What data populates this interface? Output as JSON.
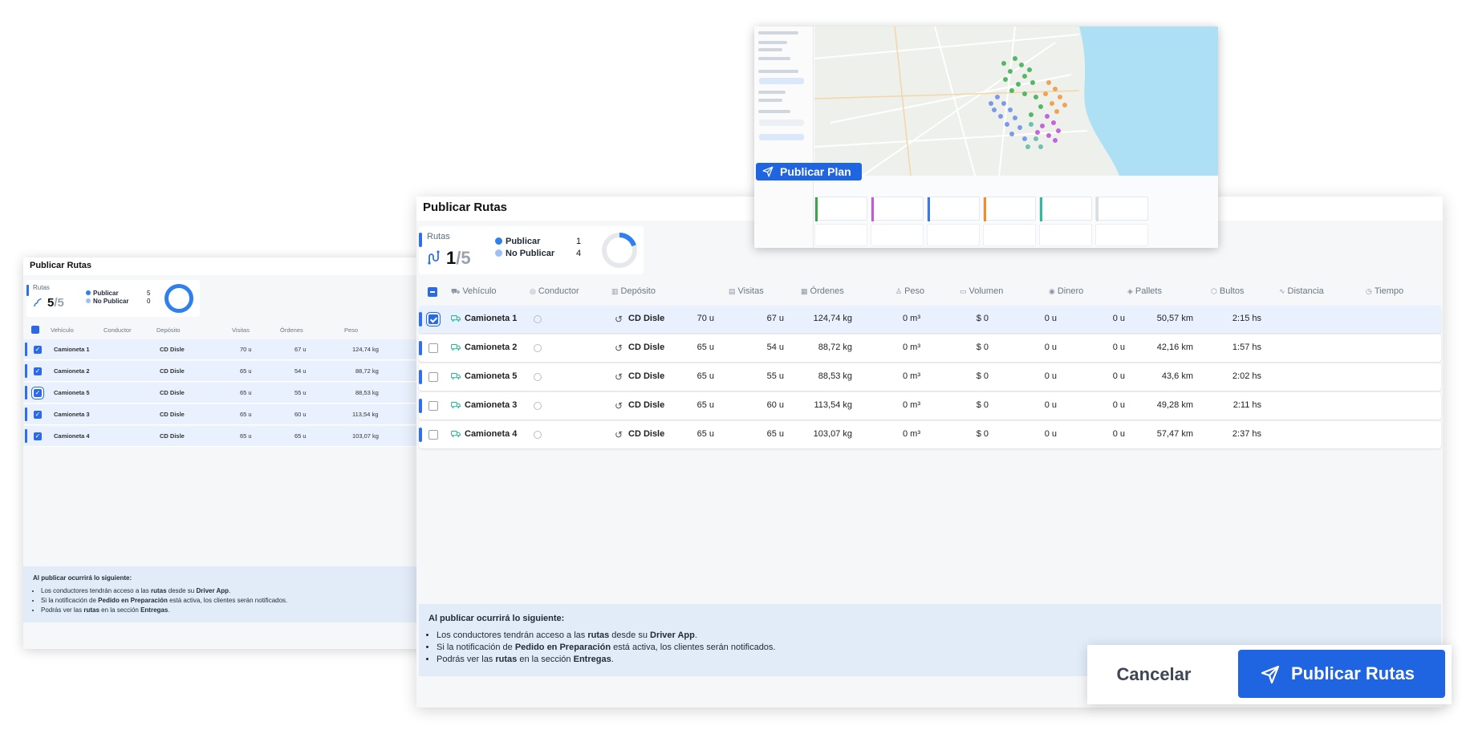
{
  "colors": {
    "accent": "#2f6fee",
    "primary_button": "#1f64e0",
    "row_selected": "#e8f1fd",
    "notes_bg": "#e2ecf9"
  },
  "back_panel": {
    "title": "Publicar Rutas",
    "summary": {
      "label": "Rutas",
      "count": "5",
      "total": "/5",
      "legend": [
        {
          "label": "Publicar",
          "value": "5",
          "color": "#2f7fed"
        },
        {
          "label": "No Publicar",
          "value": "0",
          "color": "#9cc0f5"
        }
      ]
    },
    "columns": [
      "Vehículo",
      "Conductor",
      "Depósito",
      "Visitas",
      "Órdenes",
      "Peso"
    ],
    "rows": [
      {
        "vehicle": "Camioneta 1",
        "depot": "CD Disle",
        "visits": "70 u",
        "orders": "67 u",
        "weight": "124,74 kg"
      },
      {
        "vehicle": "Camioneta 2",
        "depot": "CD Disle",
        "visits": "65 u",
        "orders": "54 u",
        "weight": "88,72 kg"
      },
      {
        "vehicle": "Camioneta 5",
        "depot": "CD Disle",
        "visits": "65 u",
        "orders": "55 u",
        "weight": "88,53 kg"
      },
      {
        "vehicle": "Camioneta 3",
        "depot": "CD Disle",
        "visits": "65 u",
        "orders": "60 u",
        "weight": "113,54 kg"
      },
      {
        "vehicle": "Camioneta 4",
        "depot": "CD Disle",
        "visits": "65 u",
        "orders": "65 u",
        "weight": "103,07 kg"
      }
    ],
    "notes": {
      "head": "Al publicar ocurrirá lo siguiente:",
      "items": [
        [
          "Los conductores tendrán acceso a las ",
          "rutas",
          " desde su ",
          "Driver App",
          "."
        ],
        [
          "Si la notificación de ",
          "Pedido en Preparación",
          " está activa, los clientes serán notificados.",
          "",
          ""
        ],
        [
          "Podrás ver las ",
          "rutas",
          " en la sección ",
          "Entregas",
          "."
        ]
      ]
    }
  },
  "main_panel": {
    "title": "Publicar Rutas",
    "summary": {
      "label": "Rutas",
      "count": "1",
      "total": "/5",
      "legend": [
        {
          "label": "Publicar",
          "value": "1",
          "color": "#2f7fed"
        },
        {
          "label": "No Publicar",
          "value": "4",
          "color": "#9cc0f5"
        }
      ],
      "publish_fraction": 0.2
    },
    "columns": [
      {
        "label": "Vehículo",
        "icon": "truck-icon"
      },
      {
        "label": "Conductor",
        "icon": "user-icon"
      },
      {
        "label": "Depósito",
        "icon": "warehouse-icon"
      },
      {
        "label": "Visitas",
        "icon": "calendar-icon"
      },
      {
        "label": "Órdenes",
        "icon": "orders-icon"
      },
      {
        "label": "Peso",
        "icon": "weight-icon"
      },
      {
        "label": "Volumen",
        "icon": "box-icon"
      },
      {
        "label": "Dinero",
        "icon": "money-icon"
      },
      {
        "label": "Pallets",
        "icon": "pallet-icon"
      },
      {
        "label": "Bultos",
        "icon": "package-icon"
      },
      {
        "label": "Distancia",
        "icon": "route-icon"
      },
      {
        "label": "Tiempo",
        "icon": "clock-icon"
      }
    ],
    "rows": [
      {
        "vehicle": "Camioneta 1",
        "depot": "CD Disle",
        "visits": "70 u",
        "orders": "67 u",
        "weight": "124,74 kg",
        "volume": "0 m³",
        "money": "$ 0",
        "pallets": "0 u",
        "bultos": "0 u",
        "distance": "50,57 km",
        "time": "2:15 hs",
        "selected": true
      },
      {
        "vehicle": "Camioneta 2",
        "depot": "CD Disle",
        "visits": "65 u",
        "orders": "54 u",
        "weight": "88,72 kg",
        "volume": "0 m³",
        "money": "$ 0",
        "pallets": "0 u",
        "bultos": "0 u",
        "distance": "42,16 km",
        "time": "1:57 hs",
        "selected": false
      },
      {
        "vehicle": "Camioneta 5",
        "depot": "CD Disle",
        "visits": "65 u",
        "orders": "55 u",
        "weight": "88,53 kg",
        "volume": "0 m³",
        "money": "$ 0",
        "pallets": "0 u",
        "bultos": "0 u",
        "distance": "43,6 km",
        "time": "2:02 hs",
        "selected": false
      },
      {
        "vehicle": "Camioneta 3",
        "depot": "CD Disle",
        "visits": "65 u",
        "orders": "60 u",
        "weight": "113,54 kg",
        "volume": "0 m³",
        "money": "$ 0",
        "pallets": "0 u",
        "bultos": "0 u",
        "distance": "49,28 km",
        "time": "2:11 hs",
        "selected": false
      },
      {
        "vehicle": "Camioneta 4",
        "depot": "CD Disle",
        "visits": "65 u",
        "orders": "65 u",
        "weight": "103,07 kg",
        "volume": "0 m³",
        "money": "$ 0",
        "pallets": "0 u",
        "bultos": "0 u",
        "distance": "57,47 km",
        "time": "2:37 hs",
        "selected": false
      }
    ],
    "notes": {
      "head": "Al publicar ocurrirá lo siguiente:",
      "items": [
        [
          "Los conductores tendrán acceso a las ",
          "rutas",
          " desde su ",
          "Driver App",
          "."
        ],
        [
          "Si la notificación de ",
          "Pedido en Preparación",
          " está activa, los clientes serán notificados.",
          "",
          ""
        ],
        [
          "Podrás ver las ",
          "rutas",
          " en la sección ",
          "Entregas",
          "."
        ]
      ]
    }
  },
  "map_card": {
    "publish_plan_label": "Publicar Plan"
  },
  "actions": {
    "cancel_label": "Cancelar",
    "publish_label": "Publicar Rutas"
  }
}
